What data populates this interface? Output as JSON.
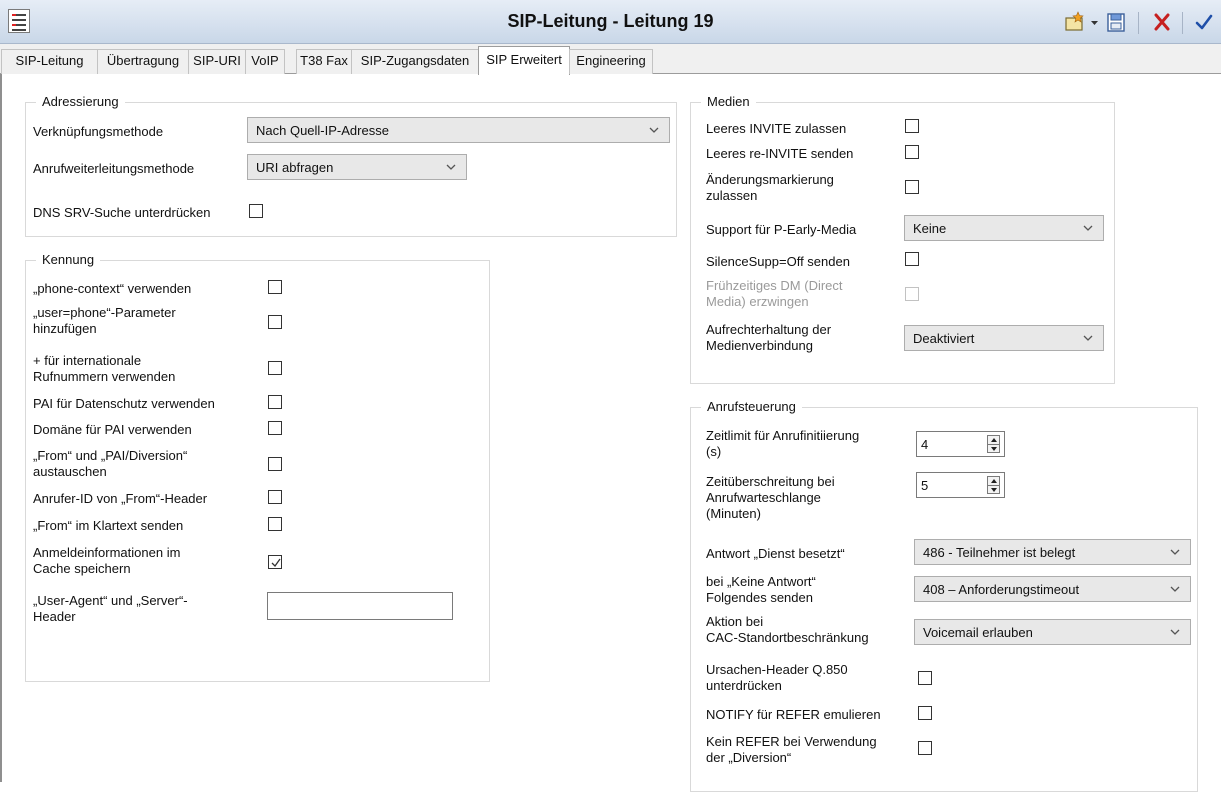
{
  "window": {
    "title": "SIP-Leitung - Leitung 19",
    "buttons": [
      "new-icon",
      "dropdown-icon",
      "save-icon",
      "cancel-icon",
      "ok-icon"
    ]
  },
  "tabs": [
    "SIP-Leitung",
    "Übertragung",
    "SIP-URI",
    "VoIP",
    "T38 Fax",
    "SIP-Zugangsdaten",
    "SIP Erweitert",
    "Engineering"
  ],
  "active_tab": "SIP Erweitert",
  "adressierung": {
    "legend": "Adressierung",
    "verknuepfung": {
      "label": "Verknüpfungsmethode",
      "value": "Nach Quell-IP-Adresse"
    },
    "weiterleitung": {
      "label": "Anrufweiterleitungsmethode",
      "value": "URI abfragen"
    },
    "dns_srv": {
      "label": "DNS SRV-Suche unterdrücken",
      "checked": false
    }
  },
  "kennung": {
    "legend": "Kennung",
    "phone_context": {
      "label": "„phone-context“ verwenden",
      "checked": false
    },
    "user_phone": {
      "label1": "„user=phone“-Parameter",
      "label2": "hinzufügen",
      "checked": false
    },
    "plus_international": {
      "label1": "+ für internationale",
      "label2": "Rufnummern verwenden",
      "checked": false
    },
    "pai_datenschutz": {
      "label": "PAI für Datenschutz verwenden",
      "checked": false
    },
    "domaene_pai": {
      "label": "Domäne für PAI verwenden",
      "checked": false
    },
    "from_pai": {
      "label1": "„From“ und „PAI/Diversion“",
      "label2": "austauschen",
      "checked": false
    },
    "anrufer_id": {
      "label": "Anrufer-ID von „From“-Header",
      "checked": false
    },
    "from_klartext": {
      "label": "„From“ im Klartext senden",
      "checked": false
    },
    "anmeldeinfo": {
      "label1": "Anmeldeinformationen im",
      "label2": "Cache speichern",
      "checked": true
    },
    "user_agent": {
      "label1": "„User-Agent“ und „Server“-",
      "label2": "Header",
      "value": ""
    }
  },
  "medien": {
    "legend": "Medien",
    "leeres_invite": {
      "label": "Leeres INVITE zulassen",
      "checked": false
    },
    "leeres_reinvite": {
      "label": "Leeres re-INVITE senden",
      "checked": false
    },
    "aenderung": {
      "label1": "Änderungsmarkierung",
      "label2": "zulassen",
      "checked": false
    },
    "p_early_media": {
      "label": "Support für P-Early-Media",
      "value": "Keine"
    },
    "silencesupp": {
      "label": "SilenceSupp=Off senden",
      "checked": false
    },
    "fruehzeitiges_dm": {
      "label1": "Frühzeitiges DM (Direct",
      "label2": "Media) erzwingen",
      "checked": false,
      "disabled": true
    },
    "aufrechterhaltung": {
      "label1": "Aufrechterhaltung der",
      "label2": "Medienverbindung",
      "value": "Deaktiviert"
    }
  },
  "anrufsteuerung": {
    "legend": "Anrufsteuerung",
    "zeitlimit": {
      "label1": "Zeitlimit für Anrufinitiierung",
      "label2": "(s)",
      "value": "4"
    },
    "zeitueberschreitung": {
      "label1": "Zeitüberschreitung bei",
      "label2": "Anrufwarteschlange",
      "label3": "(Minuten)",
      "value": "5"
    },
    "dienst_besetzt": {
      "label": "Antwort „Dienst besetzt“",
      "value": "486 - Teilnehmer ist belegt"
    },
    "keine_antwort": {
      "label1": "bei „Keine Antwort“",
      "label2": "Folgendes senden",
      "value": "408 – Anforderungstimeout"
    },
    "cac": {
      "label1": "Aktion bei",
      "label2": "CAC-Standortbeschränkung",
      "value": "Voicemail erlauben"
    },
    "q850": {
      "label1": "Ursachen-Header Q.850",
      "label2": "unterdrücken",
      "checked": false
    },
    "notify_refer": {
      "label": "NOTIFY für REFER emulieren",
      "checked": false
    },
    "kein_refer": {
      "label1": "Kein REFER bei Verwendung",
      "label2": "der „Diversion“",
      "checked": false
    }
  }
}
